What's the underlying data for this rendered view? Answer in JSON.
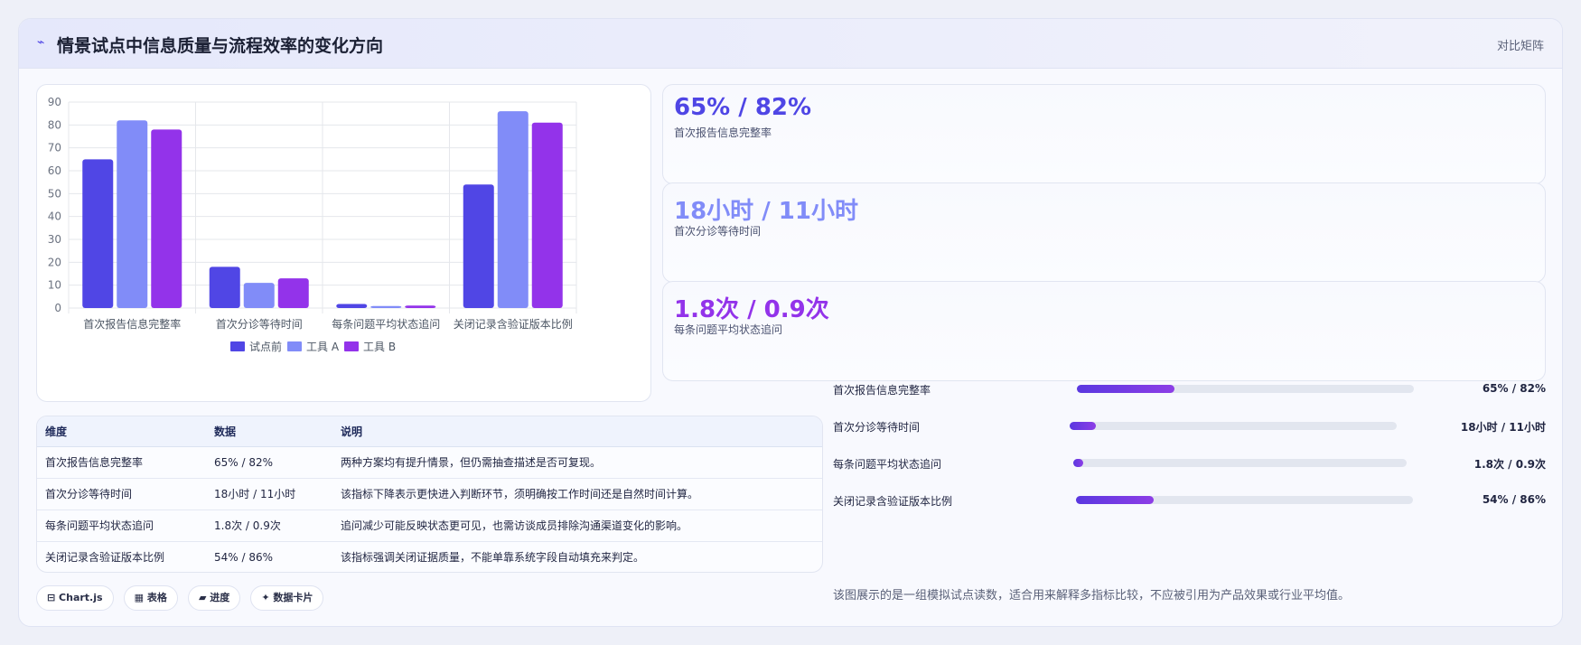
{
  "header": {
    "title": "情景试点中信息质量与流程效率的变化方向",
    "tag": "对比矩阵"
  },
  "colors": {
    "series1": "#5046e5",
    "series2": "#818cf8",
    "series3": "#9333ea"
  },
  "chart_data": {
    "type": "bar",
    "categories": [
      "首次报告信息完整率",
      "首次分诊等待时间",
      "每条问题平均状态追问",
      "关闭记录含验证版本比例"
    ],
    "series": [
      {
        "name": "试点前",
        "values": [
          65,
          18,
          1.8,
          54
        ]
      },
      {
        "name": "工具 A",
        "values": [
          82,
          11,
          0.9,
          86
        ]
      },
      {
        "name": "工具 B",
        "values": [
          78,
          13,
          1.1,
          81
        ]
      }
    ],
    "ylim": [
      0,
      90
    ],
    "yticks": [
      "0",
      "10",
      "20",
      "30",
      "40",
      "50",
      "60",
      "70",
      "80",
      "90"
    ],
    "grid": true,
    "legend": "bottom"
  },
  "kpis": [
    {
      "value": "65% / 82%",
      "label": "首次报告信息完整率"
    },
    {
      "value": "18小时 / 11小时",
      "label": "首次分诊等待时间"
    },
    {
      "value": "1.8次 / 0.9次",
      "label": "每条问题平均状态追问"
    }
  ],
  "table": {
    "headers": [
      "维度",
      "数据",
      "说明"
    ],
    "rows": [
      [
        "首次报告信息完整率",
        "65% / 82%",
        "两种方案均有提升情景，但仍需抽查描述是否可复现。"
      ],
      [
        "首次分诊等待时间",
        "18小时 / 11小时",
        "该指标下降表示更快进入判断环节，须明确按工作时间还是自然时间计算。"
      ],
      [
        "每条问题平均状态追问",
        "1.8次 / 0.9次",
        "追问减少可能反映状态更可见，也需访谈成员排除沟通渠道变化的影响。"
      ],
      [
        "关闭记录含验证版本比例",
        "54% / 86%",
        "该指标强调关闭证据质量，不能单靠系统字段自动填充来判定。"
      ]
    ]
  },
  "chips": [
    "⊟ Chart.js",
    "▦ 表格",
    "▰ 进度",
    "✦ 数据卡片"
  ],
  "progress": [
    {
      "label": "首次报告信息完整率",
      "value": "65% / 82%",
      "fraction": 0.29
    },
    {
      "label": "首次分诊等待时间",
      "value": "18小时 / 11小时",
      "fraction": 0.08
    },
    {
      "label": "每条问题平均状态追问",
      "value": "1.8次 / 0.9次",
      "fraction": 0.03
    },
    {
      "label": "关闭记录含验证版本比例",
      "value": "54% / 86%",
      "fraction": 0.23
    }
  ],
  "note": "该图展示的是一组模拟试点读数，适合用来解释多指标比较，不应被引用为产品效果或行业平均值。"
}
